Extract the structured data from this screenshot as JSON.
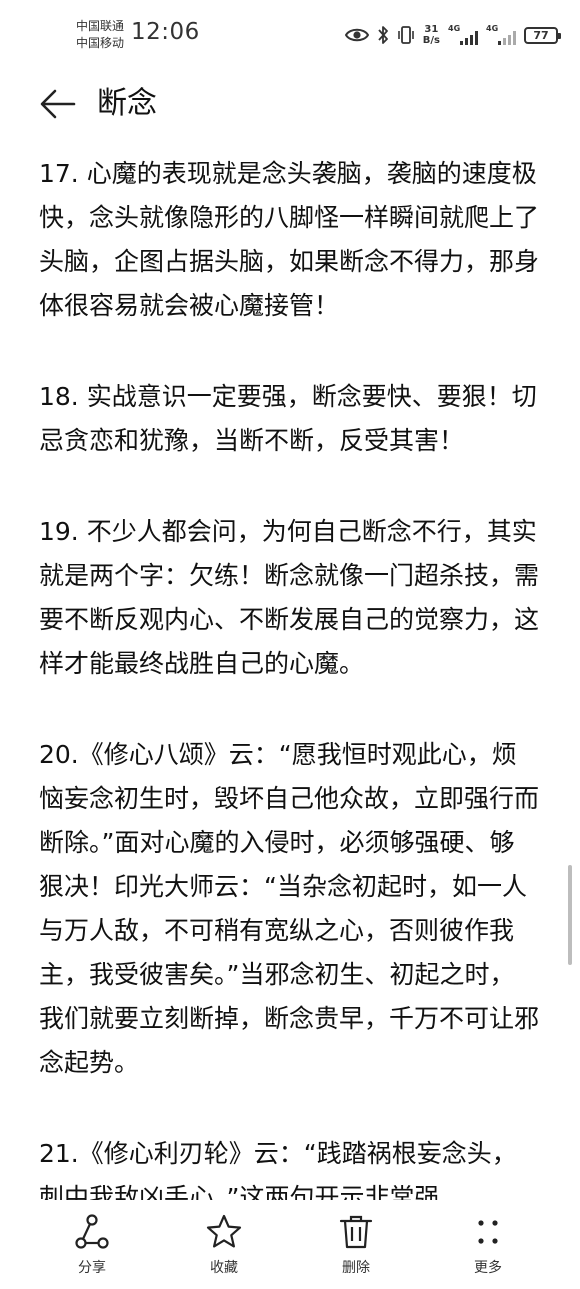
{
  "status_bar": {
    "carrier_1": "中国联通",
    "carrier_2": "中国移动",
    "time": "12:06",
    "net_speed_value": "31",
    "net_speed_unit": "B/s",
    "sim1_tag": "4G",
    "sim2_tag": "4G",
    "battery_level": "77",
    "icons": [
      "eye-icon",
      "bluetooth-icon",
      "vibrate-icon",
      "signal-icon",
      "battery-icon"
    ]
  },
  "header": {
    "title": "断念",
    "back_icon": "arrow-left-icon"
  },
  "article": {
    "paragraphs": [
      "17. 心魔的表现就是念头袭脑，袭脑的速度极快，念头就像隐形的八脚怪一样瞬间就爬上了头脑，企图占据头脑，如果断念不得力，那身体很容易就会被心魔接管！",
      "18. 实战意识一定要强，断念要快、要狠！切忌贪恋和犹豫，当断不断，反受其害！",
      "19. 不少人都会问，为何自己断念不行，其实就是两个字：欠练！断念就像一门超杀技，需要不断反观内心、不断发展自己的觉察力，这样才能最终战胜自己的心魔。",
      "20.《修心八颂》云：“愿我恒时观此心，烦恼妄念初生时，毁坏自己他众故，立即强行而断除。”面对心魔的入侵时，必须够强硬、够狠决！印光大师云：“当杂念初起时，如一人与万人敌，不可稍有宽纵之心，否则彼作我主，我受彼害矣。”当邪念初生、初起之时，我们就要立刻断掉，断念贵早，千万不可让邪念起势。",
      "21.《修心利刃轮》云：“践踏祸根妄念头，刺中我敌凶手心。”这两句开示非常强"
    ]
  },
  "toolbar": {
    "share_label": "分享",
    "favorite_label": "收藏",
    "delete_label": "删除",
    "more_label": "更多"
  }
}
